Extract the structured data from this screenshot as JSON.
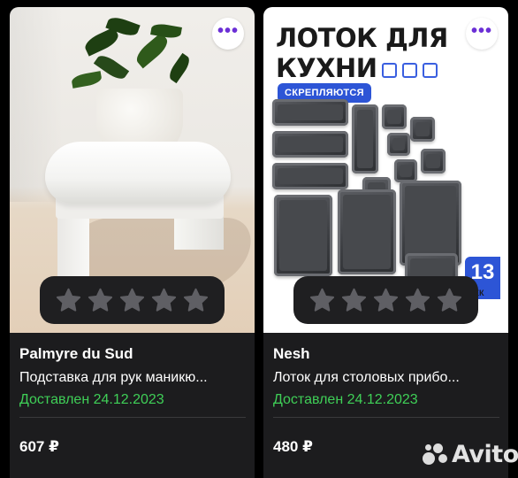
{
  "listings": [
    {
      "seller": "Palmyre du Sud",
      "title": "Подставка для рук маникю...",
      "status": "Доставлен 24.12.2023",
      "price": "607 ₽",
      "rating": {
        "filled": 0,
        "max": 5
      }
    },
    {
      "seller": "Nesh",
      "title": "Лоток для столовых прибо...",
      "status": "Доставлен 24.12.2023",
      "price": "480 ₽",
      "rating": {
        "filled": 0,
        "max": 5
      },
      "image_text": {
        "headline_1": "ЛОТОК ДЛЯ",
        "headline_2": "КУХНИ",
        "badge": "СКРЕПЛЯЮТСЯ",
        "count_badge": "13",
        "count_sub": "ЕЕК"
      }
    }
  ],
  "more_button_label": "•••",
  "watermark": "Avito",
  "colors": {
    "card_bg": "#1c1c1e",
    "status_green": "#3fcf57",
    "more_icon": "#6b2fd6",
    "promo_blue": "#2d55d6",
    "star_empty": "#5f5f64"
  }
}
